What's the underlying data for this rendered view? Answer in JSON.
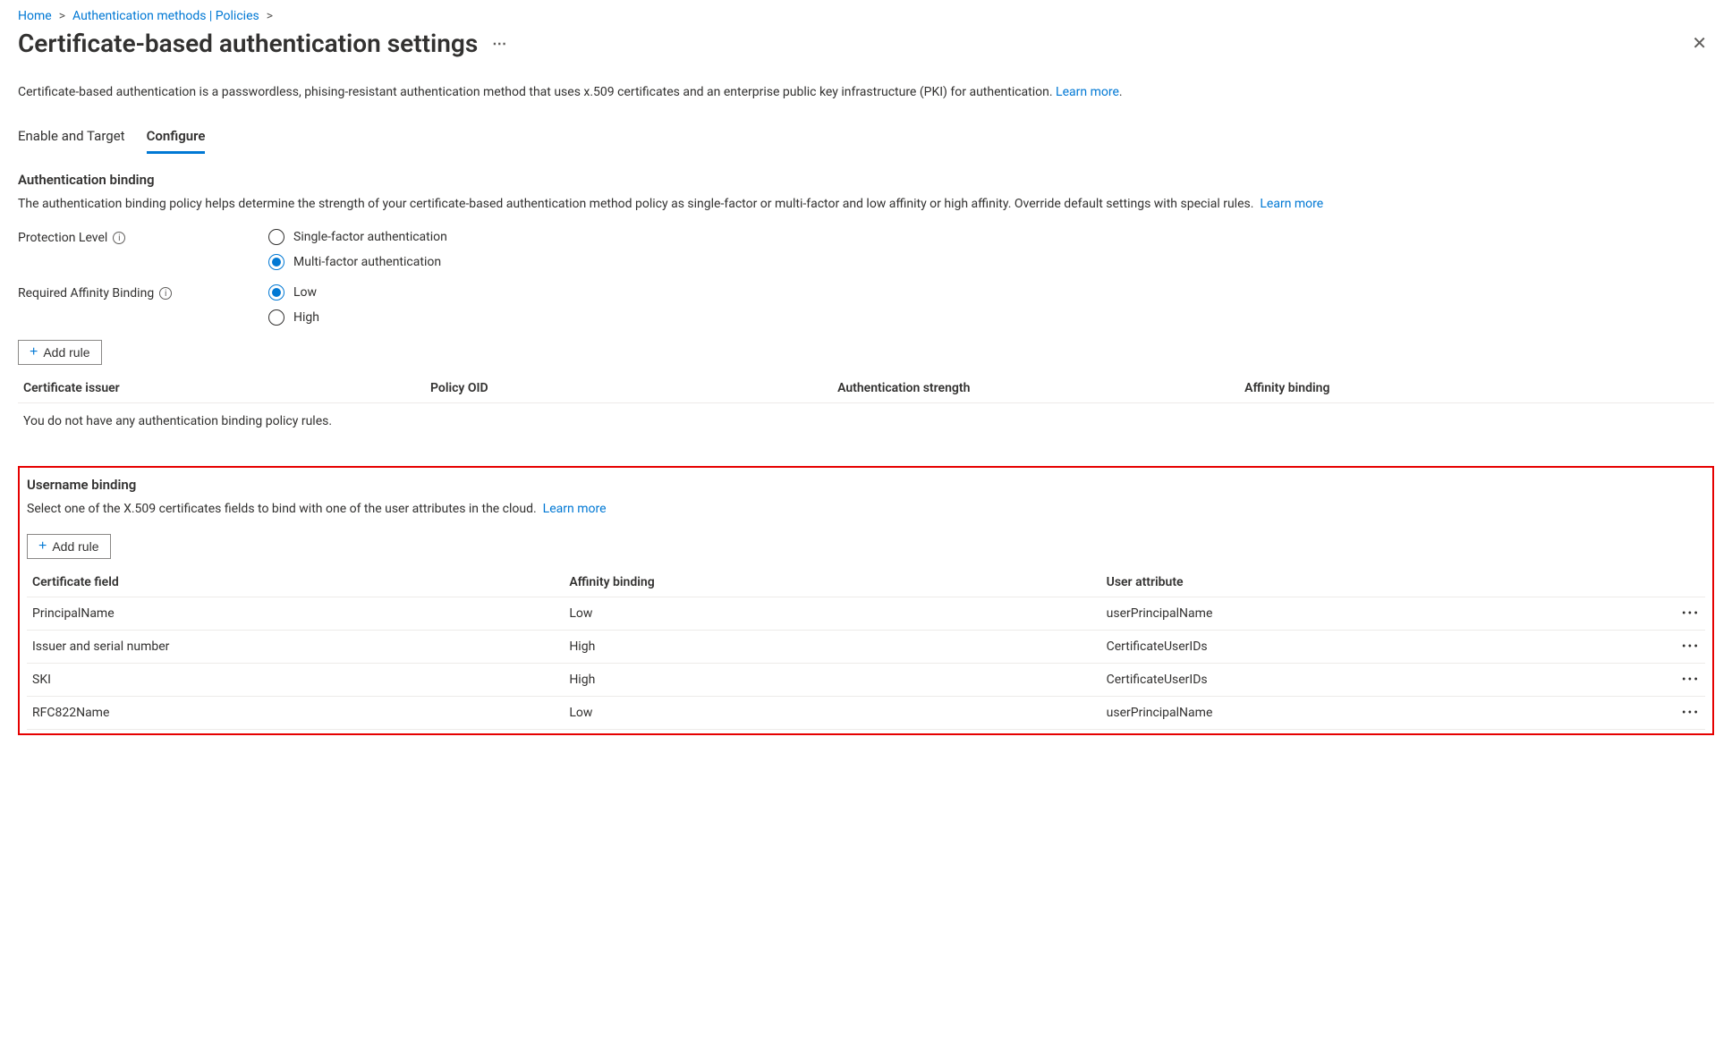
{
  "breadcrumb": {
    "home": "Home",
    "auth_methods": "Authentication methods | Policies"
  },
  "header": {
    "title": "Certificate-based authentication settings"
  },
  "description": {
    "text": "Certificate-based authentication is a passwordless, phising-resistant authentication method that uses x.509 certificates and an enterprise public key infrastructure (PKI) for authentication.",
    "learn_more": "Learn more"
  },
  "tabs": {
    "enable": "Enable and Target",
    "configure": "Configure"
  },
  "auth_binding": {
    "heading": "Authentication binding",
    "desc": "The authentication binding policy helps determine the strength of your certificate-based authentication method policy as single-factor or multi-factor and low affinity or high affinity. Override default settings with special rules.",
    "learn_more": "Learn more",
    "protection_label": "Protection Level",
    "protection_options": {
      "single": "Single-factor authentication",
      "multi": "Multi-factor authentication"
    },
    "affinity_label": "Required Affinity Binding",
    "affinity_options": {
      "low": "Low",
      "high": "High"
    },
    "add_rule": "Add rule",
    "columns": {
      "issuer": "Certificate issuer",
      "oid": "Policy OID",
      "strength": "Authentication strength",
      "affinity": "Affinity binding"
    },
    "empty": "You do not have any authentication binding policy rules."
  },
  "username_binding": {
    "heading": "Username binding",
    "desc": "Select one of the X.509 certificates fields to bind with one of the user attributes in the cloud.",
    "learn_more": "Learn more",
    "add_rule": "Add rule",
    "columns": {
      "field": "Certificate field",
      "affinity": "Affinity binding",
      "attribute": "User attribute"
    },
    "rows": [
      {
        "field": "PrincipalName",
        "affinity": "Low",
        "attribute": "userPrincipalName"
      },
      {
        "field": "Issuer and serial number",
        "affinity": "High",
        "attribute": "CertificateUserIDs"
      },
      {
        "field": "SKI",
        "affinity": "High",
        "attribute": "CertificateUserIDs"
      },
      {
        "field": "RFC822Name",
        "affinity": "Low",
        "attribute": "userPrincipalName"
      }
    ]
  }
}
